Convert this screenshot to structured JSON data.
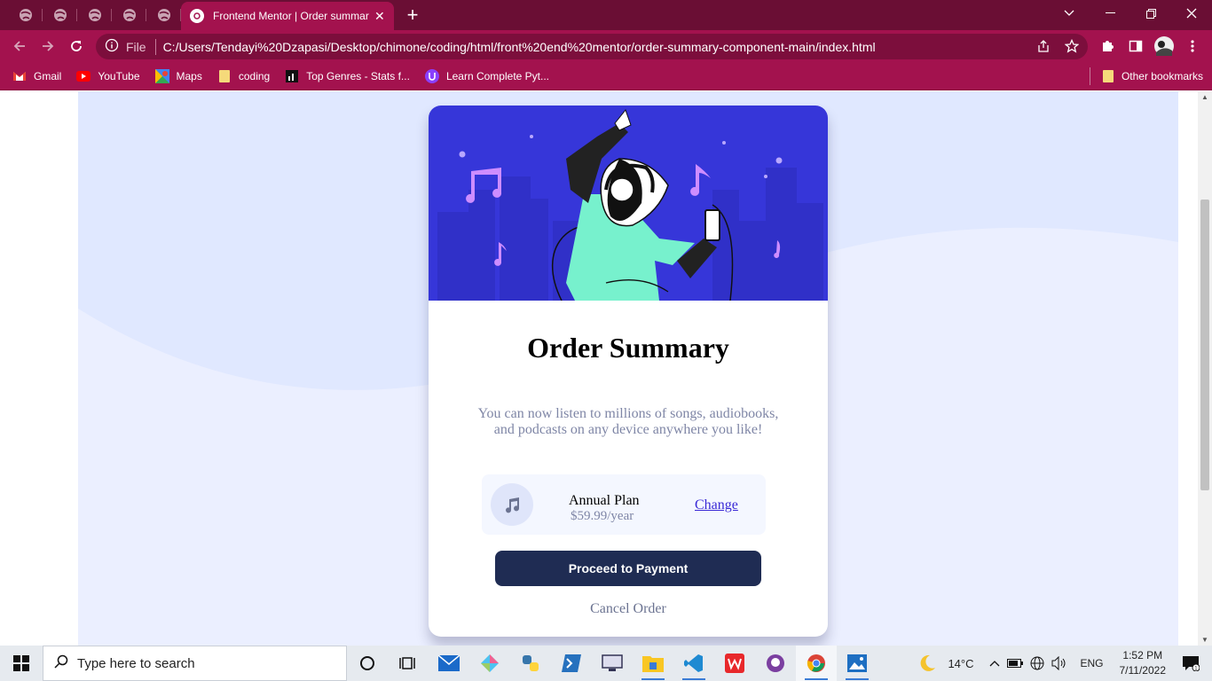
{
  "browser": {
    "active_tab_title": "Frontend Mentor | Order summary",
    "tab_close": "✕",
    "new_tab": "+",
    "url_scheme_label": "File",
    "url": "C:/Users/Tendayi%20Dzapasi/Desktop/chimone/coding/html/front%20end%20mentor/order-summary-component-main/index.html",
    "theme_color": "#a3124e"
  },
  "bookmarks": {
    "items": [
      {
        "label": "Gmail",
        "icon": "gmail-icon"
      },
      {
        "label": "YouTube",
        "icon": "youtube-icon"
      },
      {
        "label": "Maps",
        "icon": "maps-icon"
      },
      {
        "label": "coding",
        "icon": "folder-icon"
      },
      {
        "label": "Top Genres - Stats f...",
        "icon": "stats-icon"
      },
      {
        "label": "Learn Complete Pyt...",
        "icon": "course-icon"
      }
    ],
    "other": "Other bookmarks"
  },
  "card": {
    "title": "Order Summary",
    "description": "You can now listen to millions of songs, audiobooks, and podcasts on any device anywhere you like!",
    "plan_name": "Annual Plan",
    "plan_price": "$59.99/year",
    "change_link": "Change",
    "pay_button": "Proceed to Payment",
    "cancel_button": "Cancel Order",
    "hero_color": "#3636d9",
    "button_color": "#1f2c53"
  },
  "taskbar": {
    "search_placeholder": "Type here to search",
    "temperature": "14°C",
    "language": "ENG",
    "time": "1:52 PM",
    "date": "7/11/2022"
  }
}
